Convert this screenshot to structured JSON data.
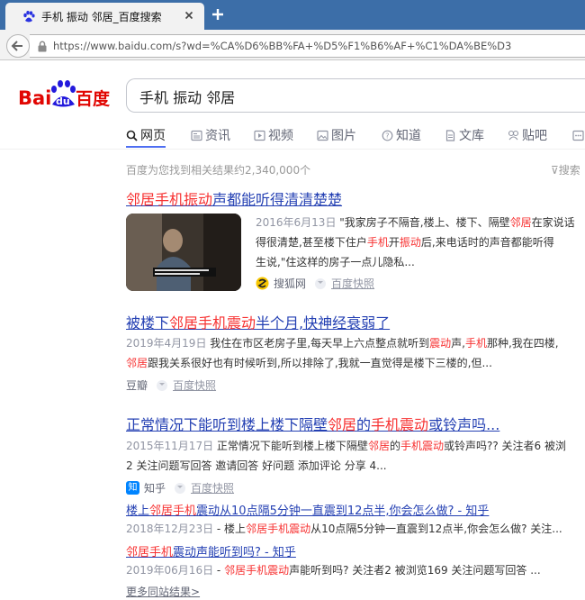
{
  "browser": {
    "tab_title": "手机 振动 邻居_百度搜索",
    "new_tab_icon": "plus-icon",
    "url": "https://www.baidu.com/s?wd=%CA%D6%BB%FA+%D5%F1%B6%AF+%C1%DA%BE%D3",
    "colors": {
      "tabstrip": "#3c6ea8",
      "toolbar": "#f2f2f2"
    }
  },
  "header": {
    "logo_text_bai": "Bai",
    "logo_text_du": "du",
    "logo_text_cn": "百度",
    "query": "手机 振动 邻居"
  },
  "tabs": [
    {
      "label": "网页",
      "icon": "search-icon",
      "active": true
    },
    {
      "label": "资讯",
      "icon": "news-icon"
    },
    {
      "label": "视频",
      "icon": "video-icon"
    },
    {
      "label": "图片",
      "icon": "image-icon"
    },
    {
      "label": "知道",
      "icon": "question-icon"
    },
    {
      "label": "文库",
      "icon": "document-icon"
    },
    {
      "label": "贴吧",
      "icon": "tieba-icon"
    },
    {
      "label": "",
      "icon": "more-icon"
    }
  ],
  "result_count": "百度为您找到相关结果约2,340,000个",
  "search_tools": "搜索",
  "results": [
    {
      "title_em": "邻居手机振动",
      "title_rest": "声都能听得清清楚楚",
      "date": "2016年6月13日",
      "line1_a": "\"我家房子不隔音,楼上、楼下、隔壁",
      "line1_em": "邻居",
      "line1_b": "在家说话",
      "line2_a": "得很清楚,甚至楼下住户",
      "line2_em1": "手机",
      "line2_b": "开",
      "line2_em2": "振动",
      "line2_c": "后,来电话时的声音都能听得",
      "line3": "生说,\"住这样的房子一点儿隐私...",
      "source": "搜狐网",
      "source_icon": "sohu-icon",
      "snapshot": "百度快照"
    },
    {
      "title_a": "被楼下",
      "title_em": "邻居手机震动",
      "title_b": "半个月,快神经衰弱了",
      "date": "2019年4月19日",
      "line1_a": "我住在市区老房子里,每天早上六点整点就听到",
      "line1_em1": "震动",
      "line1_b": "声,",
      "line1_em2": "手机",
      "line1_c": "那种,我在四楼,",
      "line2_em": "邻居",
      "line2_a": "跟我关系很好也有时候听到,所以排除了,我就一直觉得是楼下三楼的,但...",
      "source": "豆瓣",
      "snapshot": "百度快照"
    },
    {
      "title_a": "正常情况下能听到楼上楼下隔壁",
      "title_em1": "邻居",
      "title_b": "的",
      "title_em2": "手机震动",
      "title_c": "或铃声吗...",
      "date": "2015年11月17日",
      "line1_a": "正常情况下能听到楼上楼下隔壁",
      "line1_em1": "邻居",
      "line1_b": "的",
      "line1_em2": "手机震动",
      "line1_c": "或铃声吗?? 关注者6 被浏",
      "line2": "2 关注问题写回答 邀请回答 好问题 添加评论 分享 4...",
      "source": "知乎",
      "source_icon": "zhihu-icon",
      "source_badge": "知",
      "snapshot": "百度快照",
      "sub1_title_a": "楼上",
      "sub1_title_em": "邻居手机",
      "sub1_title_b": "震动从10点隔5分钟一直震到12点半,你会怎么做? - 知乎",
      "sub1_date": "2018年12月23日",
      "sub1_abs_a": " - 楼上",
      "sub1_abs_em": "邻居手机震动",
      "sub1_abs_b": "从10点隔5分钟一直震到12点半,你会怎么做? 关注...",
      "sub2_title_em": "邻居手机",
      "sub2_title_b": "震动声能听到吗? - 知乎",
      "sub2_date": "2019年06月16日",
      "sub2_abs_a": " - ",
      "sub2_abs_em": "邻居手机震动",
      "sub2_abs_b": "声能听到吗? 关注者2 被浏览169 关注问题写回答 ...",
      "more": "更多同站结果>"
    }
  ]
}
